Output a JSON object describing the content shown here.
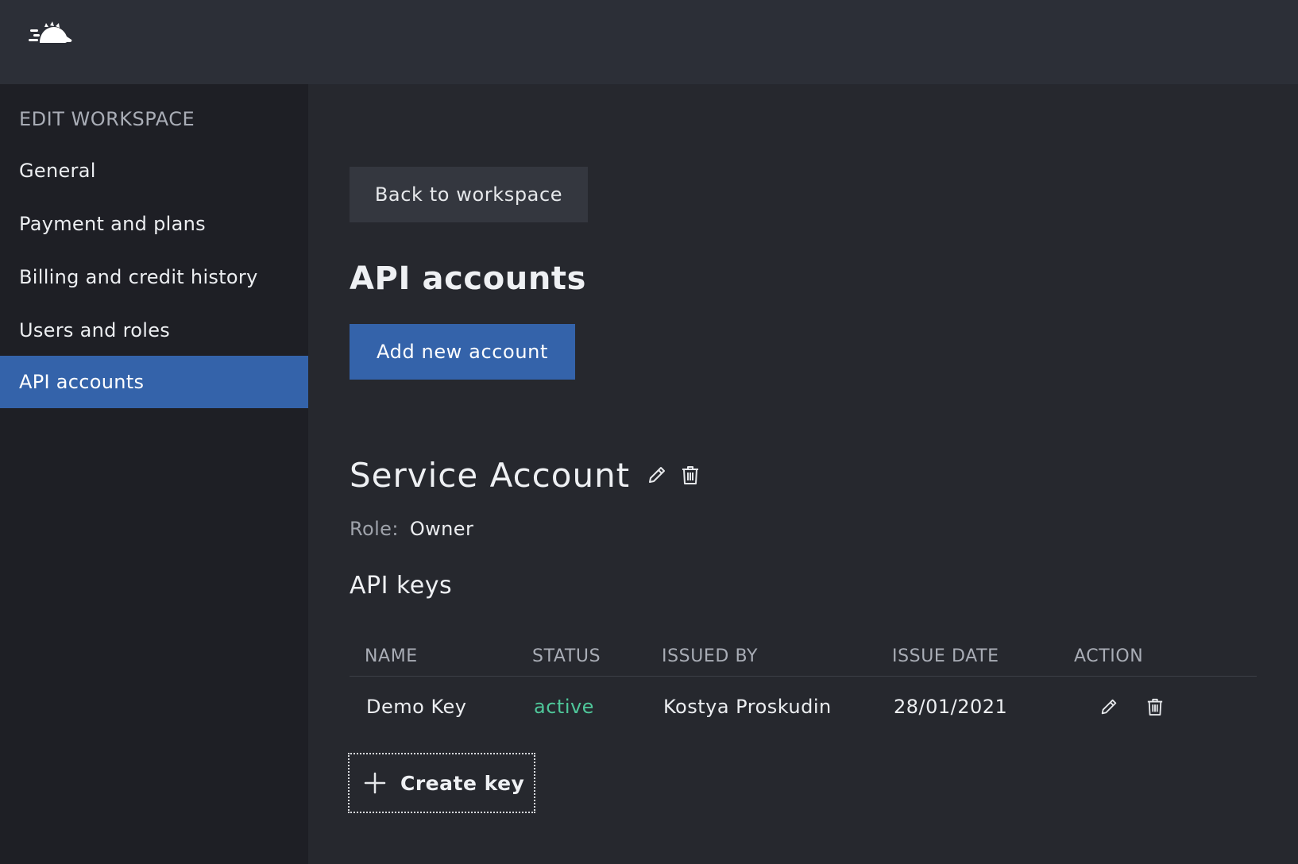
{
  "sidebar": {
    "heading": "EDIT WORKSPACE",
    "items": [
      {
        "label": "General",
        "active": false
      },
      {
        "label": "Payment and plans",
        "active": false
      },
      {
        "label": "Billing and credit history",
        "active": false
      },
      {
        "label": "Users and roles",
        "active": false
      },
      {
        "label": "API accounts",
        "active": true
      }
    ]
  },
  "main": {
    "back_label": "Back to workspace",
    "title": "API accounts",
    "add_label": "Add new account",
    "account": {
      "name": "Service Account",
      "role_label": "Role:",
      "role_value": "Owner",
      "keys_title": "API keys",
      "table": {
        "columns": [
          "NAME",
          "STATUS",
          "ISSUED BY",
          "ISSUE DATE",
          "ACTION"
        ],
        "rows": [
          {
            "name": "Demo Key",
            "status": "active",
            "issued_by": "Kostya Proskudin",
            "issue_date": "28/01/2021"
          }
        ]
      },
      "create_label": "Create key"
    }
  },
  "icons": {
    "logo": "hedgehog-logo-icon",
    "edit": "pencil-icon",
    "delete": "trash-icon",
    "plus": "plus-icon"
  },
  "colors": {
    "accent": "#3463aa",
    "active_status": "#4fc79a",
    "sidebar_bg": "#1e1f25",
    "topbar_bg": "#2c2f37",
    "main_bg": "#26282e"
  }
}
